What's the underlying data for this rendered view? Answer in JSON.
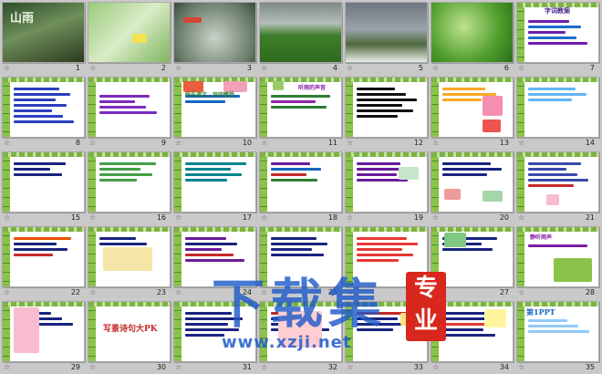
{
  "slides": [
    {
      "number": "1",
      "title": "山雨"
    },
    {
      "number": "2",
      "title": ""
    },
    {
      "number": "3",
      "title": ""
    },
    {
      "number": "4",
      "title": ""
    },
    {
      "number": "5",
      "title": ""
    },
    {
      "number": "6",
      "title": ""
    },
    {
      "number": "7",
      "title": "字词教案"
    },
    {
      "number": "8",
      "title": ""
    },
    {
      "number": "9",
      "title": ""
    },
    {
      "number": "10",
      "title": "快乐读文，异同感受"
    },
    {
      "number": "11",
      "title": "听雨的声音"
    },
    {
      "number": "12",
      "title": ""
    },
    {
      "number": "13",
      "title": ""
    },
    {
      "number": "14",
      "title": ""
    },
    {
      "number": "15",
      "title": ""
    },
    {
      "number": "16",
      "title": ""
    },
    {
      "number": "17",
      "title": ""
    },
    {
      "number": "18",
      "title": ""
    },
    {
      "number": "19",
      "title": ""
    },
    {
      "number": "20",
      "title": ""
    },
    {
      "number": "21",
      "title": ""
    },
    {
      "number": "22",
      "title": ""
    },
    {
      "number": "23",
      "title": ""
    },
    {
      "number": "24",
      "title": ""
    },
    {
      "number": "25",
      "title": ""
    },
    {
      "number": "26",
      "title": ""
    },
    {
      "number": "27",
      "title": ""
    },
    {
      "number": "28",
      "title": "静听雨声"
    },
    {
      "number": "29",
      "title": ""
    },
    {
      "number": "30",
      "title": "写景诗句大PK"
    },
    {
      "number": "31",
      "title": ""
    },
    {
      "number": "32",
      "title": ""
    },
    {
      "number": "33",
      "title": ""
    },
    {
      "number": "34",
      "title": ""
    },
    {
      "number": "35",
      "title": "第1PPT"
    }
  ],
  "watermark": {
    "brand": "下载集",
    "seal": "专业",
    "url": "www.xzji.net"
  },
  "anim_icon": "☆"
}
